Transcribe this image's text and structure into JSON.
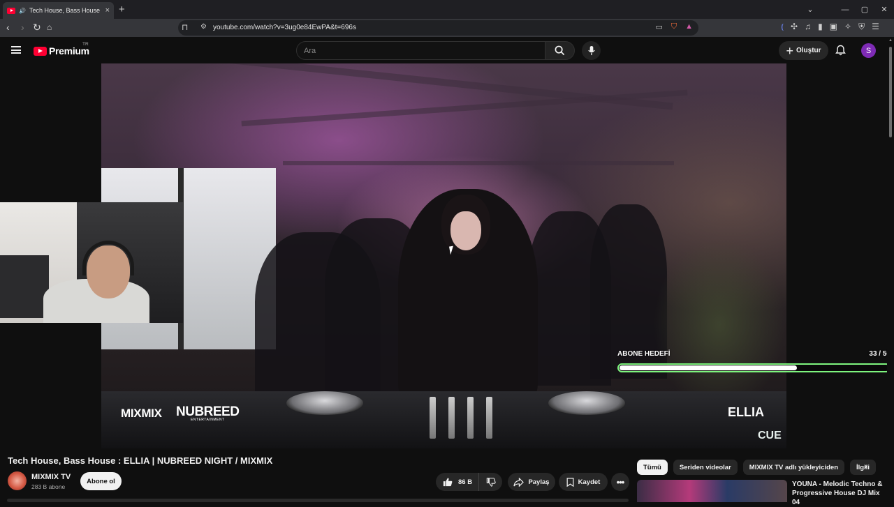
{
  "browser": {
    "tab_title": "Tech House, Bass House : ELLIA",
    "tab_close": "×",
    "new_tab": "+",
    "url": "youtube.com/watch?v=3ug0e84EwPA&t=696s",
    "window_controls": [
      "⌄",
      "—",
      "▢",
      "✕"
    ]
  },
  "youtube": {
    "brand": "Premium",
    "country": "TR",
    "search_placeholder": "Ara",
    "create_label": "Oluştur",
    "user_initial": "S"
  },
  "overlay": {
    "sub_goal_label": "ABONE HEDEFİ",
    "sub_goal_count": "33 / 50",
    "sub_goal_progress": 0.66,
    "goal_color": "#7ef57e",
    "logo_left": "MIXMIX",
    "logo_right": "NUBREED",
    "logo_right_sub": "ENTERTAINMENT",
    "artist": "ELLIA",
    "deck_label": "CUE"
  },
  "video": {
    "title": "Tech House, Bass House : ELLIA | NUBREED NIGHT / MIXMIX",
    "channel": "MIXMIX TV",
    "subscribers": "283 B abone",
    "subscribe_label": "Abone ol",
    "likes": "86 B",
    "share_label": "Paylaş",
    "save_label": "Kaydet"
  },
  "chips": [
    "Tümü",
    "Seriden videolar",
    "MIXMIX TV adlı yükleyiciden",
    "İlgili"
  ],
  "recommendation": {
    "title": "YOUNA - Melodic Techno & Progressive House DJ Mix 04"
  }
}
